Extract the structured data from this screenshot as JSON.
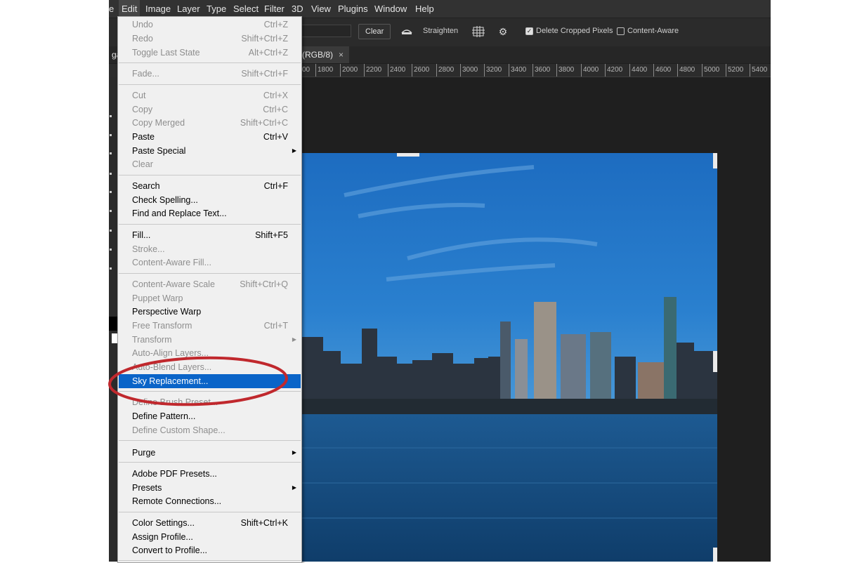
{
  "menubar": [
    "e",
    "Edit",
    "Image",
    "Layer",
    "Type",
    "Select",
    "Filter",
    "3D",
    "View",
    "Plugins",
    "Window",
    "Help"
  ],
  "options": {
    "clear_label": "Clear",
    "straighten_label": "Straighten",
    "delete_cropped_label": "Delete Cropped Pixels",
    "delete_cropped_checked": true,
    "content_aware_label": "Content-Aware",
    "content_aware_checked": false
  },
  "tabs": {
    "left_fragment": "ga",
    "doc_tab": "(RGB/8)",
    "close_glyph": "×"
  },
  "ruler": [
    "00",
    "1800",
    "2000",
    "2200",
    "2400",
    "2600",
    "2800",
    "3000",
    "3200",
    "3400",
    "3600",
    "3800",
    "4000",
    "4200",
    "4400",
    "4600",
    "4800",
    "5000",
    "5200",
    "5400"
  ],
  "menu": {
    "items": [
      {
        "label": "Undo",
        "shortcut": "Ctrl+Z",
        "disabled": true
      },
      {
        "label": "Redo",
        "shortcut": "Shift+Ctrl+Z",
        "disabled": true
      },
      {
        "label": "Toggle Last State",
        "shortcut": "Alt+Ctrl+Z",
        "disabled": true
      },
      {
        "label": "Fade...",
        "shortcut": "Shift+Ctrl+F",
        "disabled": true
      },
      {
        "label": "Cut",
        "shortcut": "Ctrl+X",
        "disabled": true
      },
      {
        "label": "Copy",
        "shortcut": "Ctrl+C",
        "disabled": true
      },
      {
        "label": "Copy Merged",
        "shortcut": "Shift+Ctrl+C",
        "disabled": true
      },
      {
        "label": "Paste",
        "shortcut": "Ctrl+V",
        "disabled": false
      },
      {
        "label": "Paste Special",
        "shortcut": "",
        "disabled": false,
        "submenu": true
      },
      {
        "label": "Clear",
        "shortcut": "",
        "disabled": true
      },
      {
        "label": "Search",
        "shortcut": "Ctrl+F",
        "disabled": false
      },
      {
        "label": "Check Spelling...",
        "shortcut": "",
        "disabled": false
      },
      {
        "label": "Find and Replace Text...",
        "shortcut": "",
        "disabled": false
      },
      {
        "label": "Fill...",
        "shortcut": "Shift+F5",
        "disabled": false
      },
      {
        "label": "Stroke...",
        "shortcut": "",
        "disabled": true
      },
      {
        "label": "Content-Aware Fill...",
        "shortcut": "",
        "disabled": true
      },
      {
        "label": "Content-Aware Scale",
        "shortcut": "Shift+Ctrl+Q",
        "disabled": true
      },
      {
        "label": "Puppet Warp",
        "shortcut": "",
        "disabled": true
      },
      {
        "label": "Perspective Warp",
        "shortcut": "",
        "disabled": false
      },
      {
        "label": "Free Transform",
        "shortcut": "Ctrl+T",
        "disabled": true
      },
      {
        "label": "Transform",
        "shortcut": "",
        "disabled": true,
        "submenu": true
      },
      {
        "label": "Auto-Align Layers...",
        "shortcut": "",
        "disabled": true
      },
      {
        "label": "Auto-Blend Layers...",
        "shortcut": "",
        "disabled": true
      },
      {
        "label": "Sky Replacement...",
        "shortcut": "",
        "disabled": false,
        "highlighted": true
      },
      {
        "label": "Define Brush Preset...",
        "shortcut": "",
        "disabled": true
      },
      {
        "label": "Define Pattern...",
        "shortcut": "",
        "disabled": false
      },
      {
        "label": "Define Custom Shape...",
        "shortcut": "",
        "disabled": true
      },
      {
        "label": "Purge",
        "shortcut": "",
        "disabled": false,
        "submenu": true
      },
      {
        "label": "Adobe PDF Presets...",
        "shortcut": "",
        "disabled": false
      },
      {
        "label": "Presets",
        "shortcut": "",
        "disabled": false,
        "submenu": true
      },
      {
        "label": "Remote Connections...",
        "shortcut": "",
        "disabled": false
      },
      {
        "label": "Color Settings...",
        "shortcut": "Shift+Ctrl+K",
        "disabled": false
      },
      {
        "label": "Assign Profile...",
        "shortcut": "",
        "disabled": false
      },
      {
        "label": "Convert to Profile...",
        "shortcut": "",
        "disabled": false
      }
    ]
  },
  "colors": {
    "highlight": "#0a64c8",
    "annotation": "#c0282d",
    "menu_bg": "#f0f0f0",
    "app_bg": "#1f1f1f"
  },
  "icons": [
    "straighten-icon",
    "grid-overlay-icon",
    "gear-icon",
    "submenu-arrow-icon",
    "close-icon"
  ]
}
